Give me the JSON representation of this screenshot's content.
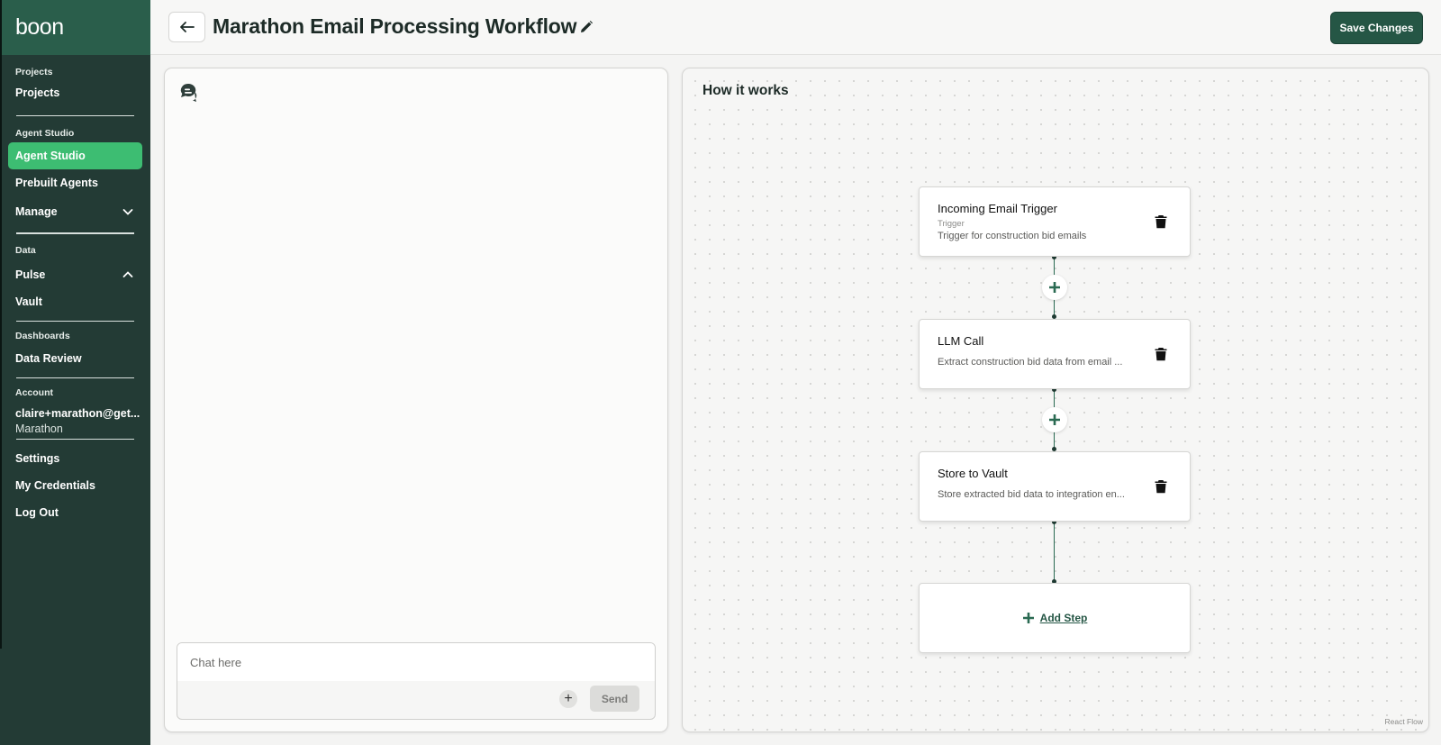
{
  "sidebar": {
    "brand": "boon",
    "sections": {
      "projects": {
        "title": "Projects",
        "items": [
          "Projects"
        ]
      },
      "agent_studio": {
        "title": "Agent Studio",
        "items": [
          "Agent Studio",
          "Prebuilt Agents",
          "Manage"
        ]
      },
      "data": {
        "title": "Data",
        "items": [
          "Pulse",
          "Vault"
        ]
      },
      "dashboards": {
        "title": "Dashboards",
        "items": [
          "Data Review"
        ]
      },
      "account": {
        "title": "Account",
        "email": "claire+marathon@get...",
        "org": "Marathon"
      },
      "footer_items": [
        "Settings",
        "My Credentials",
        "Log Out"
      ]
    },
    "active_item": "Agent Studio"
  },
  "header": {
    "title": "Marathon Email Processing Workflow",
    "save_label": "Save Changes"
  },
  "chat": {
    "placeholder": "Chat here",
    "attach_label": "+",
    "send_label": "Send"
  },
  "flow": {
    "title": "How it works",
    "nodes": [
      {
        "title": "Incoming Email Trigger",
        "type": "Trigger",
        "description": "Trigger for construction bid emails"
      },
      {
        "title": "LLM Call",
        "type": "",
        "description": "Extract construction bid data from email ..."
      },
      {
        "title": "Store to Vault",
        "type": "",
        "description": "Store extracted bid data to integration en..."
      }
    ],
    "add_step_label": "Add Step",
    "watermark": "React Flow"
  },
  "colors": {
    "sidebar_bg": "#233b35",
    "brand_bg": "#2a5e4b",
    "active_item": "#3dbd72",
    "primary_button": "#255645"
  }
}
